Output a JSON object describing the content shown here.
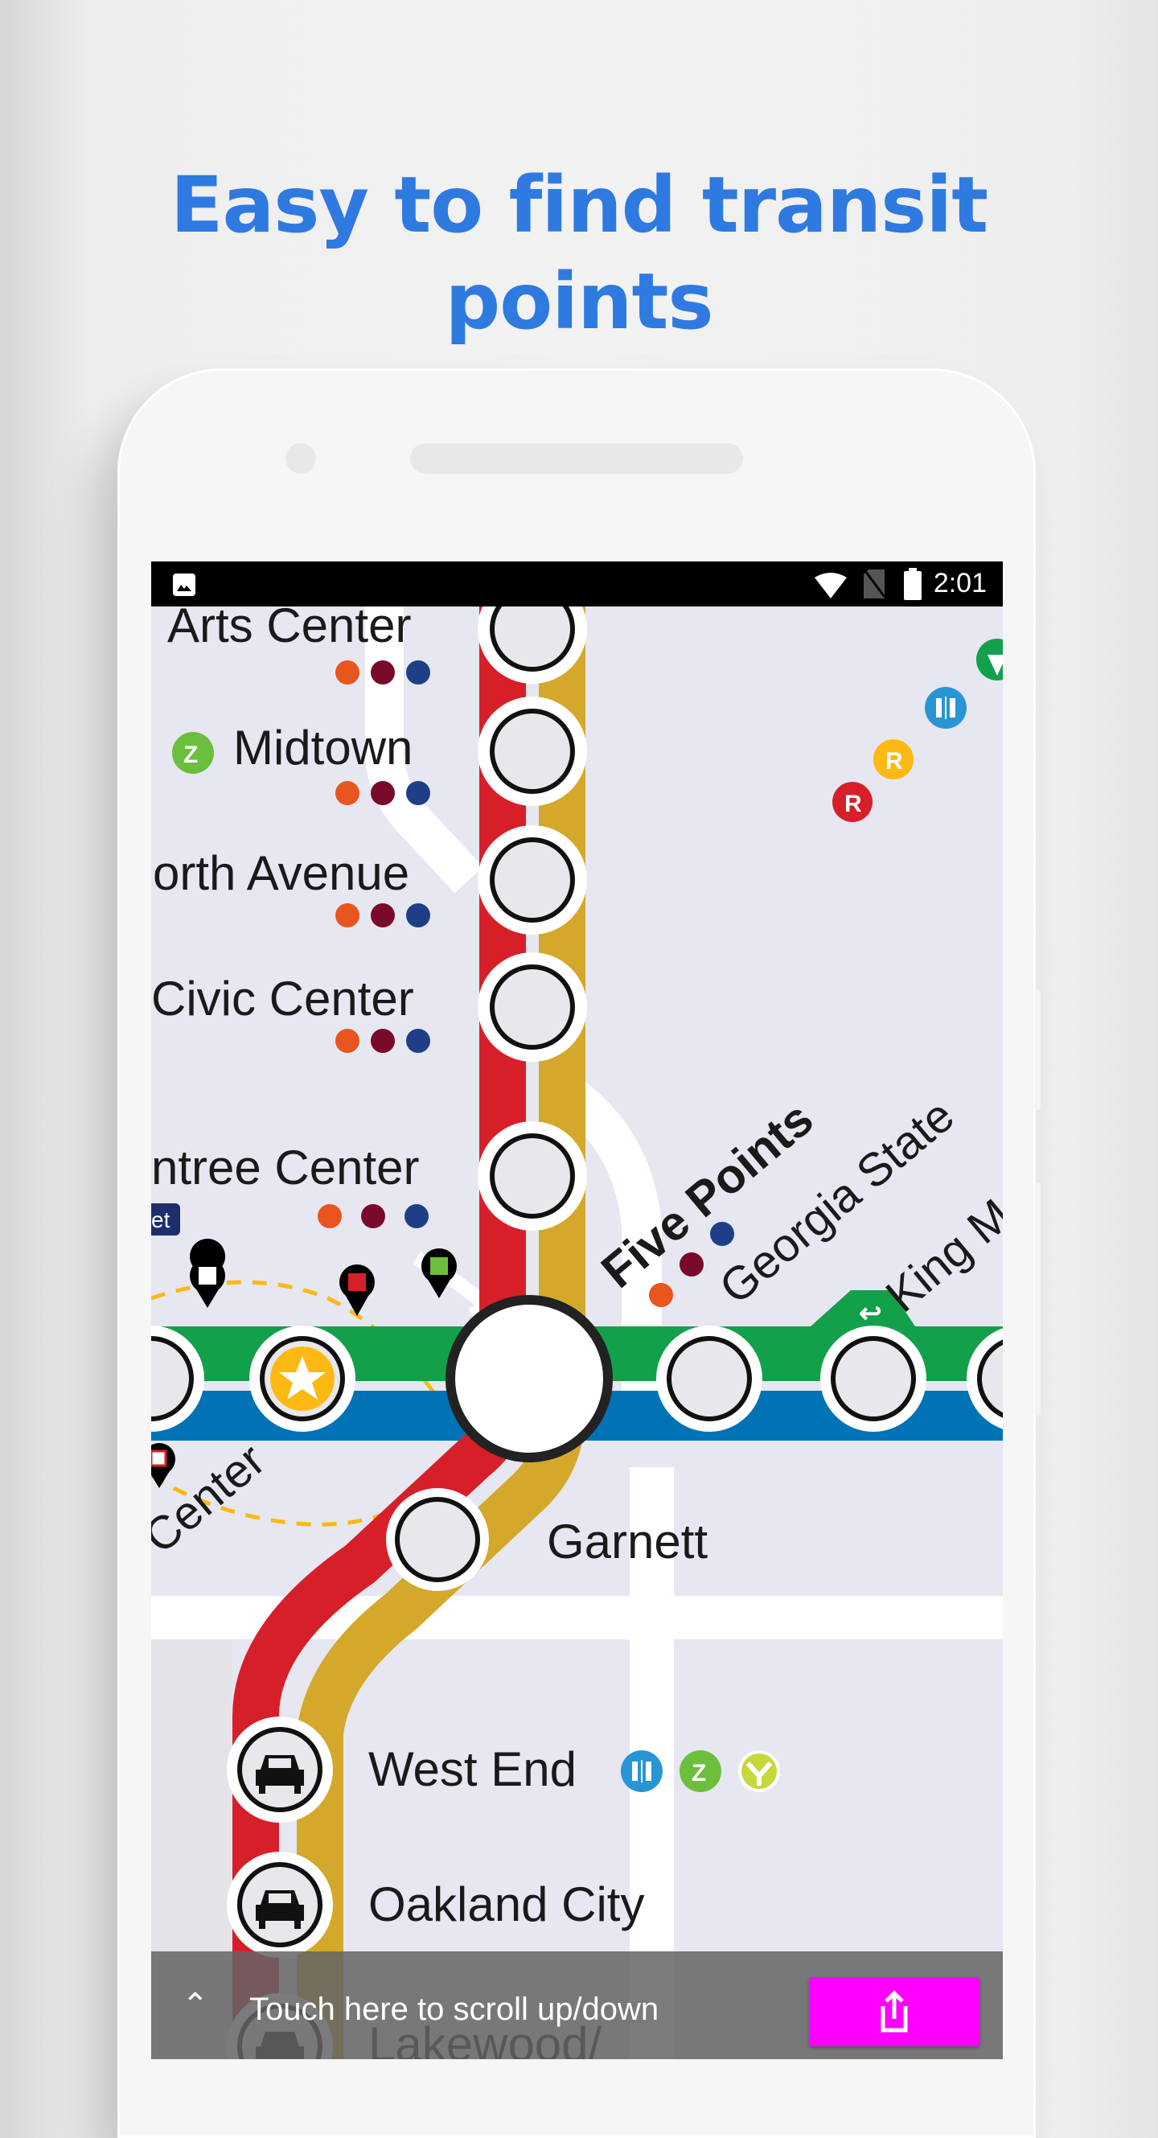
{
  "headline": {
    "line1": "Easy to find transit",
    "line2": "points"
  },
  "status_bar": {
    "left_icon": "image-notification-icon",
    "icons": [
      "wifi-icon",
      "no-sim-icon",
      "battery-icon"
    ],
    "time": "2:01"
  },
  "map": {
    "line_colors": {
      "red": "#d71f2a",
      "gold": "#d4a82a",
      "green": "#13a04b",
      "blue": "#0073b7",
      "dashed": "#fdb913"
    },
    "stations": [
      {
        "name": "Arts Center",
        "bus_dots": [
          "#e8551f",
          "#7a0a2a",
          "#1e3f87"
        ]
      },
      {
        "name": "Midtown",
        "amenity": "zipcar-icon",
        "bus_dots": [
          "#e8551f",
          "#7a0a2a",
          "#1e3f87"
        ]
      },
      {
        "name": "orth Avenue",
        "bus_dots": [
          "#e8551f",
          "#7a0a2a",
          "#1e3f87"
        ]
      },
      {
        "name": "Civic Center",
        "bus_dots": [
          "#e8551f",
          "#7a0a2a",
          "#1e3f87"
        ]
      },
      {
        "name": "ntree Center",
        "bus_dots": [
          "#e8551f",
          "#7a0a2a",
          "#1e3f87"
        ]
      },
      {
        "name": "Five Points"
      },
      {
        "name": "Georgia State"
      },
      {
        "name": "King M"
      },
      {
        "name": "Center"
      },
      {
        "name": "Garnett"
      },
      {
        "name": "West End",
        "amenities": [
          "restroom-icon",
          "zipcar-icon",
          "relay-bike-icon"
        ]
      },
      {
        "name": "Oakland City"
      },
      {
        "name": "Lakewood/"
      }
    ],
    "streetcar_badge": "et",
    "five_points_amenities": [
      "red-R-icon",
      "yellow-R-icon",
      "restroom-icon",
      "umbrella-icon"
    ]
  },
  "bottom_bar": {
    "scroll_hint": "Touch here to scroll up/down",
    "share_color": "#ff00ff"
  }
}
